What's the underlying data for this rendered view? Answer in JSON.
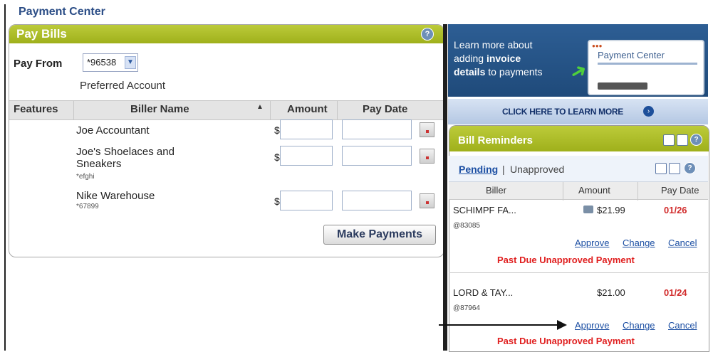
{
  "page": {
    "title": "Payment Center"
  },
  "pay_bills": {
    "title": "Pay Bills",
    "help": "?",
    "pay_from_label": "Pay From",
    "account_selected": "*96538",
    "preferred_label": "Preferred Account",
    "columns": {
      "features": "Features",
      "biller_name": "Biller Name",
      "amount": "Amount",
      "pay_date": "Pay Date"
    },
    "billers": [
      {
        "name": "Joe Accountant",
        "code": "",
        "currency": "$",
        "amount": "",
        "pay_date": ""
      },
      {
        "name": "Joe's Shoelaces and Sneakers",
        "code": "*efghi",
        "currency": "$",
        "amount": "",
        "pay_date": ""
      },
      {
        "name": "Nike Warehouse",
        "code": "*67899",
        "currency": "$",
        "amount": "",
        "pay_date": ""
      }
    ],
    "make_payments_label": "Make Payments"
  },
  "promo": {
    "line1": "Learn more about",
    "line2_prefix": "adding ",
    "line2_bold": "invoice",
    "line3_bold": "details",
    "line3_suffix": " to payments",
    "preview_title": "Payment Center",
    "cta": "CLICK HERE TO LEARN MORE"
  },
  "bill_reminders": {
    "title": "Bill Reminders",
    "help": "?",
    "filter_active": "Pending",
    "filter_separator": " | ",
    "filter_other": "Unapproved",
    "columns": {
      "biller": "Biller",
      "amount": "Amount",
      "pay_date": "Pay Date"
    },
    "rows": [
      {
        "biller": "SCHIMPF FA...",
        "code": "@83085",
        "amount": "$21.99",
        "pay_date": "01/26",
        "approve": "Approve",
        "change": "Change",
        "cancel": "Cancel",
        "status": "Past Due Unapproved Payment"
      },
      {
        "biller": "LORD & TAY...",
        "code": "@87964",
        "amount": "$21.00",
        "pay_date": "01/24",
        "approve": "Approve",
        "change": "Change",
        "cancel": "Cancel",
        "status": "Past Due Unapproved Payment"
      }
    ]
  },
  "colors": {
    "header_green": "#aebd26",
    "promo_blue": "#2d5e94",
    "link_blue": "#1c4fa3",
    "alert_red": "#e01f1f"
  }
}
